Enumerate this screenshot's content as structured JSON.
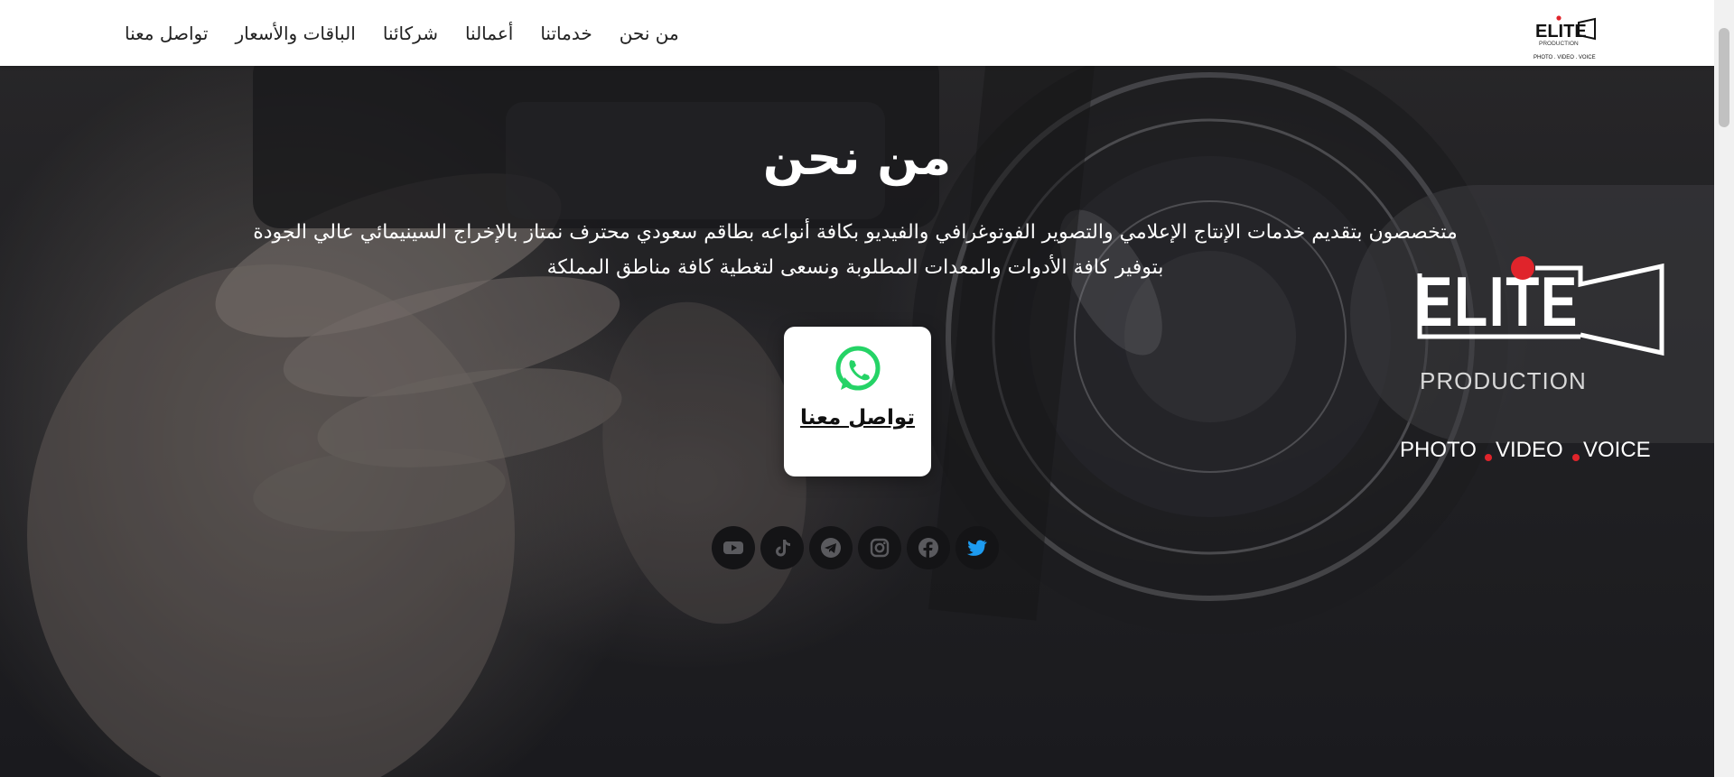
{
  "nav": {
    "items": [
      {
        "label": "تواصل معنا",
        "name": "nav-contact"
      },
      {
        "label": "الباقات والأسعار",
        "name": "nav-packages"
      },
      {
        "label": "شركائنا",
        "name": "nav-partners"
      },
      {
        "label": "أعمالنا",
        "name": "nav-works"
      },
      {
        "label": "خدماتنا",
        "name": "nav-services"
      },
      {
        "label": "من نحن",
        "name": "nav-about"
      }
    ],
    "logo": {
      "brand": "ELITE",
      "sub": "PRODUCTION",
      "tagline": "PHOTO . VIDEO . VOICE"
    }
  },
  "hero": {
    "title": "من نحن",
    "description": "متخصصون بتقديم خدمات الإنتاج الإعلامي والتصوير الفوتوغرافي والفيديو بكافة أنواعه بطاقم سعودي محترف نمتاز بالإخراج السينيمائي عالي الجودة بتوفير كافة الأدوات والمعدات المطلوبة ونسعى لتغطية كافة مناطق المملكة",
    "contact_label": "تواصل معنا",
    "logo": {
      "brand": "ELITE",
      "sub": "PRODUCTION",
      "tagline_1": "PHOTO",
      "tagline_2": "VIDEO",
      "tagline_3": "VOICE"
    }
  },
  "social": [
    {
      "icon": "youtube-icon"
    },
    {
      "icon": "tiktok-icon"
    },
    {
      "icon": "telegram-icon"
    },
    {
      "icon": "instagram-icon"
    },
    {
      "icon": "facebook-icon"
    },
    {
      "icon": "twitter-icon"
    }
  ],
  "colors": {
    "accent_red": "#e0242b",
    "whatsapp_green": "#25d366",
    "twitter_blue": "#1d9bf0",
    "social_grey": "#5a5a5e"
  }
}
